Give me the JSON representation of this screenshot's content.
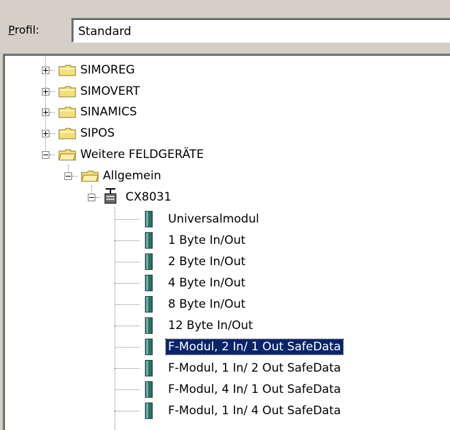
{
  "profile": {
    "label_prefix": "P",
    "label_rest": "rofil:",
    "value": "Standard"
  },
  "tree": {
    "nodes": [
      {
        "label": "SIMOREG",
        "icon": "folder-icon",
        "expander": "plus"
      },
      {
        "label": "SIMOVERT",
        "icon": "folder-icon",
        "expander": "plus"
      },
      {
        "label": "SINAMICS",
        "icon": "folder-icon",
        "expander": "plus"
      },
      {
        "label": "SIPOS",
        "icon": "folder-icon",
        "expander": "plus"
      },
      {
        "label": "Weitere FELDGERÄTE",
        "icon": "folder-icon",
        "expander": "minus"
      },
      {
        "label": "Allgemein",
        "icon": "folder-icon",
        "expander": "minus"
      },
      {
        "label": "CX8031",
        "icon": "device-icon",
        "expander": "minus"
      },
      {
        "label": "Universalmodul",
        "icon": "module-icon"
      },
      {
        "label": "1 Byte In/Out",
        "icon": "module-icon"
      },
      {
        "label": "2 Byte In/Out",
        "icon": "module-icon"
      },
      {
        "label": "4 Byte In/Out",
        "icon": "module-icon"
      },
      {
        "label": "8 Byte In/Out",
        "icon": "module-icon"
      },
      {
        "label": "12 Byte In/Out",
        "icon": "module-icon"
      },
      {
        "label": "F-Modul, 2 In/ 1 Out SafeData",
        "icon": "module-icon",
        "selected": true
      },
      {
        "label": "F-Modul, 1 In/ 2 Out SafeData",
        "icon": "module-icon"
      },
      {
        "label": "F-Modul, 4 In/ 1 Out SafeData",
        "icon": "module-icon"
      },
      {
        "label": "F-Modul, 1 In/ 4 Out SafeData",
        "icon": "module-icon"
      }
    ]
  },
  "colors": {
    "selection": "#0a246a",
    "folder": "#f4e07a",
    "module": "#2f6f6a"
  }
}
